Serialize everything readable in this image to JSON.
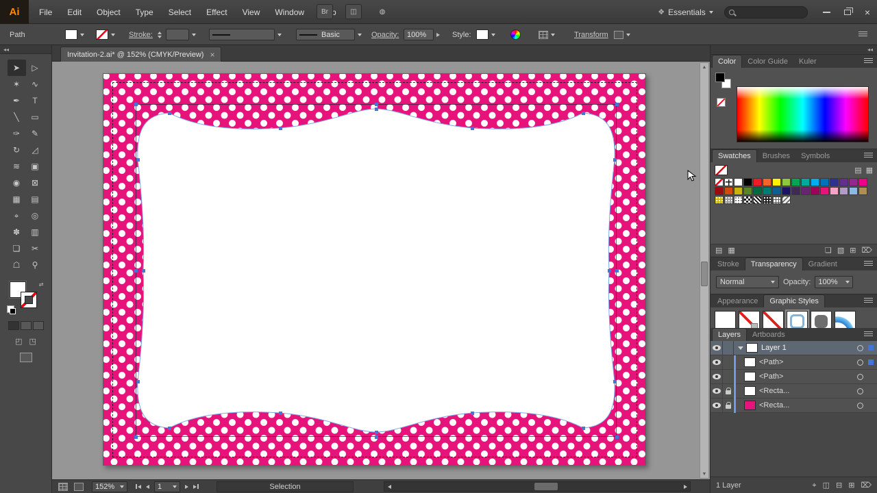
{
  "app": {
    "logo": "Ai"
  },
  "colors": {
    "accent_pink": "#e6137b",
    "selection_blue": "#4575d9",
    "canvas_gray": "#969696"
  },
  "menu_bar": {
    "menus": [
      "File",
      "Edit",
      "Object",
      "Type",
      "Select",
      "Effect",
      "View",
      "Window",
      "Help"
    ],
    "bridge_button": "Br",
    "workspace_label": "Essentials",
    "search_value": "",
    "close_glyph": "×"
  },
  "control_bar": {
    "selection_type": "Path",
    "stroke_link": "Stroke:",
    "brush_name": "Basic",
    "opacity_link": "Opacity:",
    "opacity_value": "100%",
    "style_label": "Style:",
    "transform_link": "Transform"
  },
  "toolbar": {
    "fill_color": "#ffffff",
    "stroke_color": "none",
    "tools": [
      {
        "name": "selection-tool",
        "glyph": "➤",
        "active": true
      },
      {
        "name": "direct-selection-tool",
        "glyph": "▷"
      },
      {
        "name": "magic-wand-tool",
        "glyph": "✶"
      },
      {
        "name": "lasso-tool",
        "glyph": "∿"
      },
      {
        "name": "pen-tool",
        "glyph": "✒"
      },
      {
        "name": "type-tool",
        "glyph": "T"
      },
      {
        "name": "line-segment-tool",
        "glyph": "╲"
      },
      {
        "name": "rectangle-tool",
        "glyph": "▭"
      },
      {
        "name": "paintbrush-tool",
        "glyph": "✑"
      },
      {
        "name": "pencil-tool",
        "glyph": "✎"
      },
      {
        "name": "rotate-tool",
        "glyph": "↻"
      },
      {
        "name": "scale-tool",
        "glyph": "◿"
      },
      {
        "name": "width-tool",
        "glyph": "≋"
      },
      {
        "name": "free-transform-tool",
        "glyph": "▣"
      },
      {
        "name": "shape-builder-tool",
        "glyph": "◉"
      },
      {
        "name": "perspective-grid-tool",
        "glyph": "⊠"
      },
      {
        "name": "mesh-tool",
        "glyph": "▦"
      },
      {
        "name": "gradient-tool",
        "glyph": "▤"
      },
      {
        "name": "eyedropper-tool",
        "glyph": "⌖"
      },
      {
        "name": "blend-tool",
        "glyph": "◎"
      },
      {
        "name": "symbol-sprayer-tool",
        "glyph": "✽"
      },
      {
        "name": "column-graph-tool",
        "glyph": "▥"
      },
      {
        "name": "artboard-tool",
        "glyph": "❏"
      },
      {
        "name": "slice-tool",
        "glyph": "✂"
      },
      {
        "name": "hand-tool",
        "glyph": "☖"
      },
      {
        "name": "zoom-tool",
        "glyph": "⚲"
      }
    ]
  },
  "document": {
    "tab_title": "Invitation-2.ai* @ 152% (CMYK/Preview)",
    "close_glyph": "×"
  },
  "status_bar": {
    "zoom": "152%",
    "artboard_current": "1",
    "tool_status": "Selection"
  },
  "panels": {
    "color": {
      "tabs": [
        "Color",
        "Color Guide",
        "Kuler"
      ],
      "active_tab": "Color"
    },
    "swatches": {
      "tabs": [
        "Swatches",
        "Brushes",
        "Symbols"
      ],
      "active_tab": "Swatches",
      "view_icons": [
        {
          "name": "list-view-icon",
          "glyph": "▤"
        },
        {
          "name": "thumbnail-view-icon",
          "glyph": "▦"
        }
      ],
      "rows": [
        [
          {
            "p": "none"
          },
          {
            "p": "reg"
          },
          "#ffffff",
          "#000000",
          "#ed1c24",
          "#f26522",
          "#fff200",
          "#8dc63f",
          "#00a651",
          "#00a99d",
          "#00aeef",
          "#0072bc",
          "#2e3192",
          "#662d91",
          "#92278f",
          "#ec008c"
        ],
        [
          "#9e0b0f",
          "#cf4a0c",
          "#c7b20e",
          "#598527",
          "#00693e",
          "#007a74",
          "#0d5f8f",
          "#1b1464",
          "#3f2a56",
          "#6d2077",
          "#9e005d",
          "#e6137b",
          "#f5a3c7",
          "#b39bc8",
          "#8db8e3",
          "#b08d57"
        ],
        [
          {
            "p": "dots-gold"
          },
          {
            "p": "dots-gray"
          },
          {
            "p": "dots-white"
          },
          {
            "p": "checks"
          },
          {
            "p": "hounds"
          },
          {
            "p": "dots-black"
          },
          {
            "p": "grid"
          },
          {
            "p": "diag"
          },
          null,
          null,
          null,
          null,
          null,
          null,
          null,
          null
        ]
      ],
      "footer_icons_left": [
        {
          "name": "swatch-libraries-icon",
          "glyph": "▤"
        },
        {
          "name": "swatch-kinds-icon",
          "glyph": "▦"
        }
      ],
      "footer_icons_right": [
        {
          "name": "swatch-options-icon",
          "glyph": "❏"
        },
        {
          "name": "new-color-group-icon",
          "glyph": "▧"
        },
        {
          "name": "new-swatch-icon",
          "glyph": "⊞"
        },
        {
          "name": "delete-swatch-icon",
          "glyph": "⌦"
        }
      ]
    },
    "transparency": {
      "tabs": [
        "Stroke",
        "Transparency",
        "Gradient"
      ],
      "active_tab": "Transparency",
      "blend_mode": "Normal",
      "opacity_label": "Opacity:",
      "opacity_value": "100%"
    },
    "graphic_styles": {
      "tabs": [
        "Appearance",
        "Graphic Styles"
      ],
      "active_tab": "Graphic Styles",
      "styles": [
        {
          "name": "default-graphic-style",
          "kind": "default"
        },
        {
          "name": "no-fill-fold-style",
          "kind": "slash-fold"
        },
        {
          "name": "no-fill-style",
          "kind": "slash"
        },
        {
          "name": "blue-rounded-style",
          "kind": "blue-round",
          "selected": true
        },
        {
          "name": "gray-rounded-style",
          "kind": "gray-round"
        },
        {
          "name": "blue-arc-style",
          "kind": "arc"
        },
        {
          "name": "teal-texture-style",
          "kind": "teal"
        }
      ],
      "footer_icons_left": [
        {
          "name": "style-libraries-icon",
          "glyph": "▤"
        }
      ],
      "footer_icons_right": [
        {
          "name": "break-link-icon",
          "glyph": "⧉"
        },
        {
          "name": "new-style-icon",
          "glyph": "⊞"
        },
        {
          "name": "delete-style-icon",
          "glyph": "⌦"
        }
      ]
    },
    "layers": {
      "tabs": [
        "Layers",
        "Artboards"
      ],
      "active_tab": "Layers",
      "rows": [
        {
          "label": "Layer 1",
          "kind": "layer",
          "selected": true,
          "eye": true,
          "lock": false,
          "thumb": "#ffffff",
          "sel_indicator": "filled"
        },
        {
          "label": "<Path>",
          "kind": "object",
          "eye": true,
          "lock": false,
          "thumb": "#ffffff",
          "sel_indicator": "filled"
        },
        {
          "label": "<Path>",
          "kind": "object",
          "eye": true,
          "lock": false,
          "thumb": "#ffffff",
          "sel_indicator": "none"
        },
        {
          "label": "<Recta...",
          "kind": "object",
          "eye": true,
          "lock": true,
          "thumb": "#ffffff",
          "sel_indicator": "none"
        },
        {
          "label": "<Recta...",
          "kind": "object",
          "eye": true,
          "lock": true,
          "thumb": "#e6137b",
          "sel_indicator": "none"
        }
      ],
      "footer_label": "1 Layer",
      "footer_icons": [
        {
          "name": "locate-object-icon",
          "glyph": "⌖"
        },
        {
          "name": "make-clip-mask-icon",
          "glyph": "◫"
        },
        {
          "name": "new-sublayer-icon",
          "glyph": "⊟"
        },
        {
          "name": "new-layer-icon",
          "glyph": "⊞"
        },
        {
          "name": "delete-layer-icon",
          "glyph": "⌦"
        }
      ]
    }
  }
}
